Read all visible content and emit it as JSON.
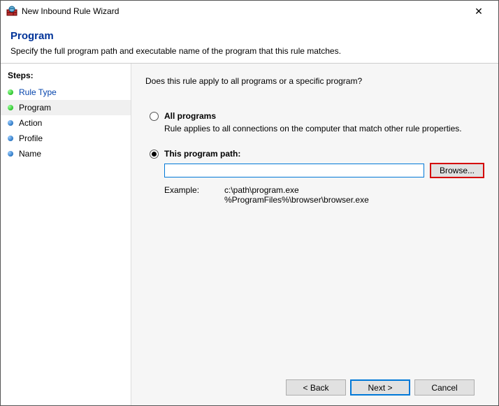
{
  "window": {
    "title": "New Inbound Rule Wizard",
    "close_glyph": "✕"
  },
  "header": {
    "heading": "Program",
    "subtitle": "Specify the full program path and executable name of the program that this rule matches."
  },
  "sidebar": {
    "label": "Steps:",
    "items": [
      {
        "label": "Rule Type",
        "state": "completed"
      },
      {
        "label": "Program",
        "state": "current"
      },
      {
        "label": "Action",
        "state": "pending"
      },
      {
        "label": "Profile",
        "state": "pending"
      },
      {
        "label": "Name",
        "state": "pending"
      }
    ]
  },
  "content": {
    "question": "Does this rule apply to all programs or a specific program?",
    "option_all": {
      "label": "All programs",
      "desc": "Rule applies to all connections on the computer that match other rule properties."
    },
    "option_path": {
      "label": "This program path:",
      "value": "",
      "browse": "Browse...",
      "example_label": "Example:",
      "example1": "c:\\path\\program.exe",
      "example2": "%ProgramFiles%\\browser\\browser.exe"
    }
  },
  "footer": {
    "back": "< Back",
    "next": "Next >",
    "cancel": "Cancel"
  }
}
